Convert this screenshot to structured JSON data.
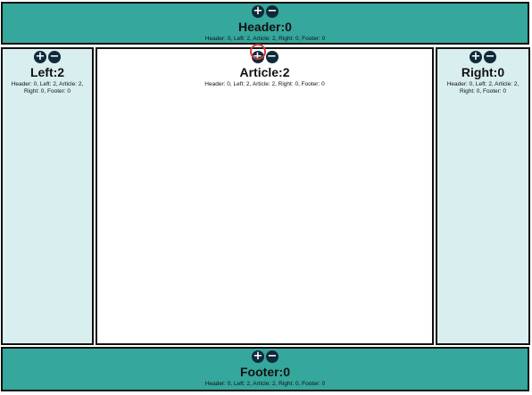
{
  "panels": {
    "header": {
      "title": "Header:0",
      "counts": "Header: 0, Left: 2, Article: 2, Right: 0, Footer: 0"
    },
    "left": {
      "title": "Left:2",
      "counts": "Header: 0, Left: 2, Article: 2, Right: 0, Footer: 0"
    },
    "article": {
      "title": "Article:2",
      "counts": "Header: 0, Left: 2, Article: 2, Right: 0, Footer: 0"
    },
    "right": {
      "title": "Right:0",
      "counts": "Header: 0, Left: 2, Article: 2, Right: 0, Footer: 0"
    },
    "footer": {
      "title": "Footer:0",
      "counts": "Header: 0, Left: 2, Article: 2, Right: 0, Footer: 0"
    }
  },
  "controls": {
    "plus": "+",
    "minus": "−"
  },
  "colors": {
    "teal": "#35a79c",
    "light": "#d9eeee",
    "button": "#0f2a3a",
    "cursor": "#d13a3a"
  }
}
